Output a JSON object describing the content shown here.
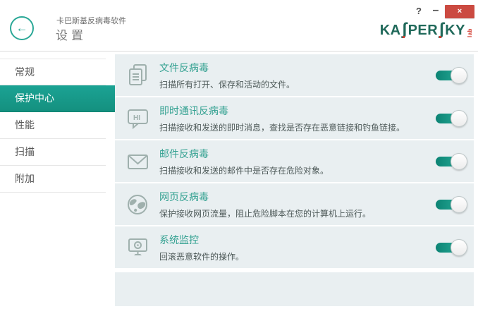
{
  "header": {
    "app_title": "卡巴斯基反病毒软件",
    "page_title": "设置",
    "help_label": "?",
    "minimize_label": "–",
    "close_label": "×",
    "logo": {
      "part1": "KA",
      "s1": "ʃ",
      "part2": "PER",
      "s2": "ʃ",
      "part3": "KY",
      "lab": "lab"
    }
  },
  "sidebar": {
    "items": [
      {
        "label": "常规",
        "selected": false
      },
      {
        "label": "保护中心",
        "selected": true
      },
      {
        "label": "性能",
        "selected": false
      },
      {
        "label": "扫描",
        "selected": false
      },
      {
        "label": "附加",
        "selected": false
      }
    ]
  },
  "features": [
    {
      "icon": "file-antivirus-icon",
      "title": "文件反病毒",
      "description": "扫描所有打开、保存和活动的文件。",
      "enabled": true,
      "toggle_state": "on"
    },
    {
      "icon": "im-antivirus-icon",
      "icon_text": "HI",
      "title": "即时通讯反病毒",
      "description": "扫描接收和发送的即时消息，查找是否存在恶意链接和钓鱼链接。",
      "enabled": true,
      "toggle_state": "on"
    },
    {
      "icon": "mail-antivirus-icon",
      "title": "邮件反病毒",
      "description": "扫描接收和发送的邮件中是否存在危险对象。",
      "enabled": true,
      "toggle_state": "on"
    },
    {
      "icon": "web-antivirus-icon",
      "title": "网页反病毒",
      "description": "保护接收网页流量，阻止危险脚本在您的计算机上运行。",
      "enabled": true,
      "toggle_state": "on"
    },
    {
      "icon": "system-watcher-icon",
      "title": "系统监控",
      "description": "回滚恶意软件的操作。",
      "enabled": true,
      "toggle_state": "on"
    }
  ],
  "colors": {
    "accent_teal": "#18a08d",
    "row_background": "#e9eff1",
    "title_teal": "#31a090",
    "close_red": "#cb4a41",
    "logo_green": "#20695a",
    "logo_red": "#d23b2f",
    "icon_gray": "#9fb0ad"
  }
}
